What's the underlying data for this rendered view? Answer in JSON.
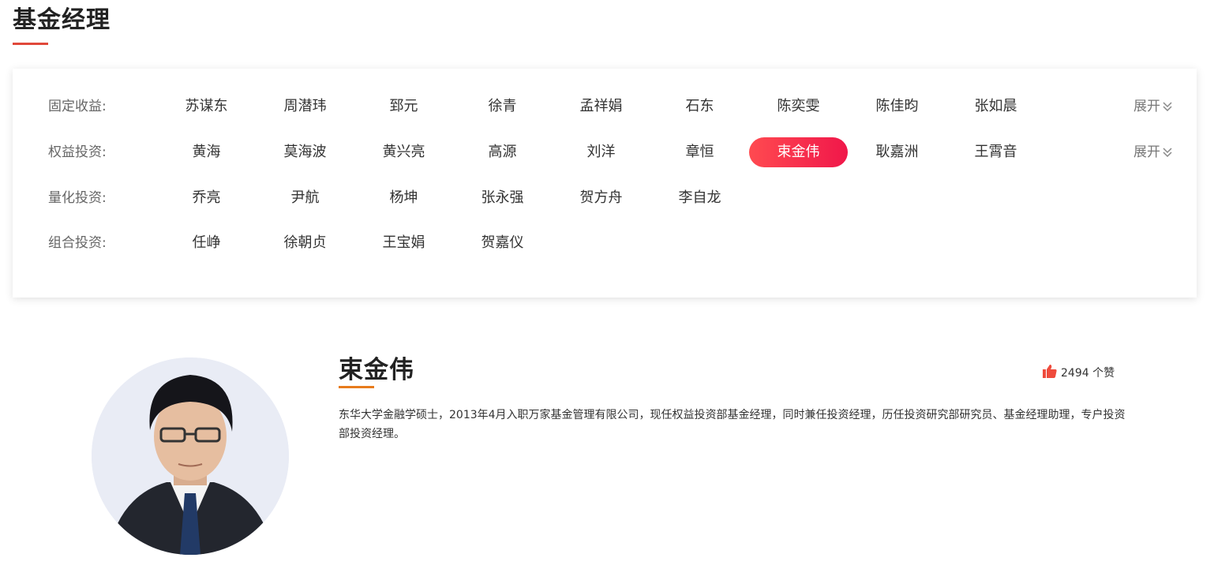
{
  "page": {
    "title": "基金经理"
  },
  "filters": {
    "rows": [
      {
        "label": "固定收益:",
        "managers": [
          "苏谋东",
          "周潜玮",
          "郅元",
          "徐青",
          "孟祥娟",
          "石东",
          "陈奕雯",
          "陈佳昀",
          "张如晨"
        ],
        "expand": "展开"
      },
      {
        "label": "权益投资:",
        "managers": [
          "黄海",
          "莫海波",
          "黄兴亮",
          "高源",
          "刘洋",
          "章恒",
          "束金伟",
          "耿嘉洲",
          "王霄音"
        ],
        "expand": "展开"
      },
      {
        "label": "量化投资:",
        "managers": [
          "乔亮",
          "尹航",
          "杨坤",
          "张永强",
          "贺方舟",
          "李自龙"
        ]
      },
      {
        "label": "组合投资:",
        "managers": [
          "任峥",
          "徐朝贞",
          "王宝娟",
          "贺嘉仪"
        ]
      }
    ],
    "selected": "束金伟"
  },
  "profile": {
    "name": "束金伟",
    "likes_count": "2494",
    "likes_unit": "个赞",
    "likes_icon": "thumbs-up-icon",
    "bio": "东华大学金融学硕士，2013年4月入职万家基金管理有限公司，现任权益投资部基金经理，同时兼任投资经理，历任投资研究部研究员、基金经理助理，专户投资部投资经理。"
  },
  "colors": {
    "accent_red": "#e0483a",
    "active_gradient_start": "#ff4a50",
    "active_gradient_end": "#f0174a",
    "name_underline": "#e77b1c",
    "likes_icon": "#ef4b3c"
  }
}
